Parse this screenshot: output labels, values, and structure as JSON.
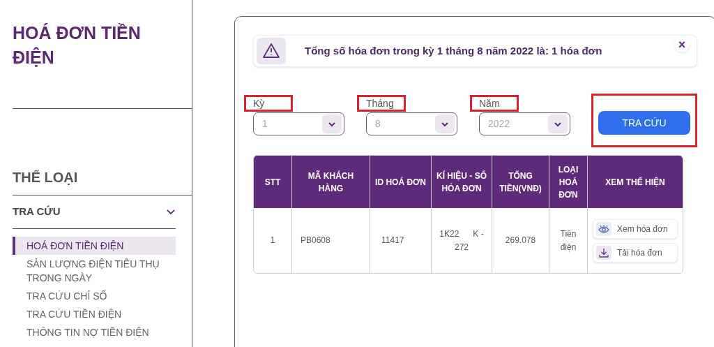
{
  "sidebar": {
    "title": "HOÁ ĐƠN TIỀN ĐIỆN",
    "section_title": "THỂ LOẠI",
    "group": {
      "label": "TRA CỨU",
      "expanded": true
    },
    "items": [
      {
        "label": "HOÁ ĐƠN TIỀN ĐIỆN",
        "selected": true
      },
      {
        "label": "SẢN LƯỢNG ĐIỆN TIÊU THỤ TRONG NGÀY",
        "selected": false
      },
      {
        "label": "TRA CỨU CHỈ SỐ",
        "selected": false
      },
      {
        "label": "TRA CỨU TIỀN ĐIỆN",
        "selected": false
      },
      {
        "label": "THÔNG TIN NỢ TIỀN ĐIỆN",
        "selected": false
      }
    ]
  },
  "alert": {
    "message": "Tổng số hóa đơn trong kỳ 1 tháng 8 năm 2022 là: 1 hóa đơn",
    "close": "×"
  },
  "filters": [
    {
      "label": "Kỳ",
      "value": "1",
      "highlighted": true
    },
    {
      "label": "Tháng",
      "value": "8",
      "highlighted": true
    },
    {
      "label": "Năm",
      "value": "2022",
      "highlighted": true
    }
  ],
  "search_button": {
    "label": "TRA CỨU",
    "highlighted": true
  },
  "table": {
    "columns": [
      "STT",
      "MÃ KHÁCH HÀNG",
      "ID HOÁ ĐƠN",
      "KÍ HIỆU - SỐ HÓA ĐƠN",
      "TỔNG TIỀN(VNĐ)",
      "LOẠI HOÁ ĐƠN",
      "XEM THỂ HIỆN"
    ],
    "rows": [
      {
        "cells": [
          "1",
          "PB0608",
          "11417",
          "1K22      K - 272",
          "269.078",
          "Tiền điện"
        ],
        "actions": [
          {
            "kind": "view",
            "label": "Xem hóa đơn"
          },
          {
            "kind": "download",
            "label": "Tải hóa đơn"
          }
        ]
      }
    ]
  }
}
